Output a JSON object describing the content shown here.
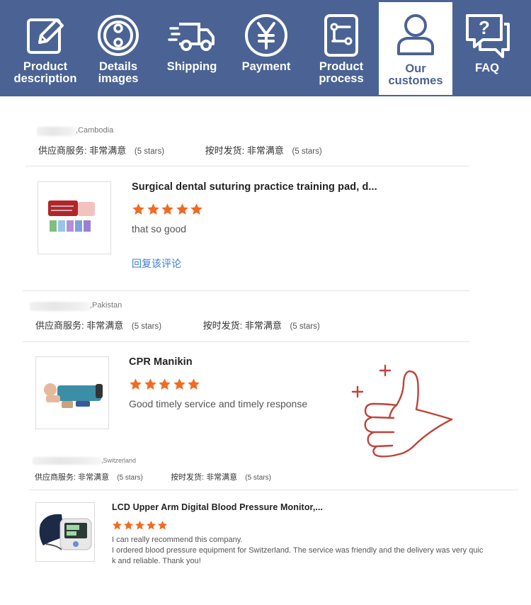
{
  "nav": {
    "bg_color": "#4a6394",
    "tabs": [
      {
        "label": "Product\ndescription",
        "icon": "edit-icon"
      },
      {
        "label": "Details\nimages",
        "icon": "details-icon"
      },
      {
        "label": "Shipping",
        "icon": "truck-icon"
      },
      {
        "label": "Payment",
        "icon": "yen-icon"
      },
      {
        "label": "Product\nprocess",
        "icon": "process-icon"
      },
      {
        "label": "Our\ncustomes",
        "icon": "user-icon",
        "active": true
      },
      {
        "label": "FAQ",
        "icon": "faq-icon"
      }
    ]
  },
  "reviews": [
    {
      "country": ",Cambodia",
      "supplier_label": "供应商服务:",
      "supplier_value": "非常满意",
      "supplier_stars": "(5 stars)",
      "ship_label": "按时发货:",
      "ship_value": "非常满意",
      "ship_stars": "(5 stars)",
      "product": "Surgical dental suturing practice training pad, d...",
      "rating": 5,
      "comment": "that so good",
      "reply": "回复该评论",
      "thumb_icon": "suture-kit-image"
    },
    {
      "country": ",Pakistan",
      "supplier_label": "供应商服务:",
      "supplier_value": "非常满意",
      "supplier_stars": "(5 stars)",
      "ship_label": "按时发货:",
      "ship_value": "非常满意",
      "ship_stars": "(5 stars)",
      "product": "CPR Manikin",
      "rating": 5,
      "comment": "Good timely service and timely response",
      "thumb_icon": "cpr-manikin-image"
    },
    {
      "country": ",Switzerland",
      "supplier_label": "供应商服务:",
      "supplier_value": "非常满意",
      "supplier_stars": "(5 stars)",
      "ship_label": "按时发货:",
      "ship_value": "非常满意",
      "ship_stars": "(5 stars)",
      "product": "LCD Upper Arm Digital Blood Pressure Monitor,...",
      "rating": 5,
      "comment_lines": [
        "I can really recommend this company.",
        "I ordered blood pressure equipment for Switzerland. The service was friendly and the delivery was very quic",
        "k and reliable. Thank you!"
      ],
      "thumb_icon": "blood-pressure-monitor-image"
    }
  ],
  "colors": {
    "star": "#f26a21",
    "reply_link": "#3a7bd5",
    "thumbs_up": "#c0433a"
  },
  "decor": {
    "thumbs_icon": "thumbs-up-icon"
  }
}
